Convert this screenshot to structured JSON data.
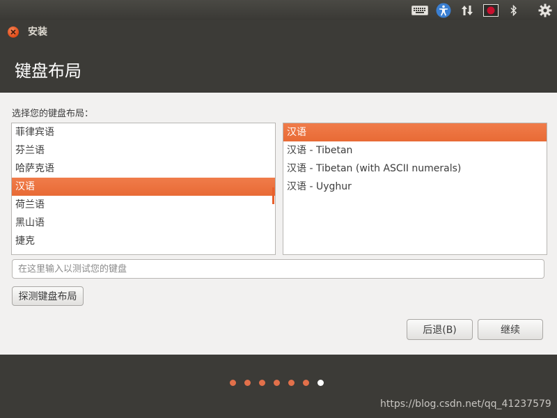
{
  "window": {
    "title": "安装"
  },
  "header": {
    "title": "键盘布局"
  },
  "keyboard": {
    "prompt": "选择您的键盘布局：",
    "layouts": [
      "菲律宾语",
      "芬兰语",
      "哈萨克语",
      "汉语",
      "荷兰语",
      "黑山语",
      "捷克"
    ],
    "selected_layout": "汉语",
    "variants": [
      "汉语",
      "汉语 - Tibetan",
      "汉语 - Tibetan (with ASCII numerals)",
      "汉语 - Uyghur"
    ],
    "selected_variant": "汉语"
  },
  "test_input": {
    "placeholder": "在这里输入以测试您的键盘",
    "value": ""
  },
  "buttons": {
    "detect": "探测键盘布局",
    "back": "后退(B)",
    "continue": "继续"
  },
  "progress": {
    "total_steps": 7,
    "current_step": 7
  },
  "watermark": "https://blog.csdn.net/qq_41237579",
  "colors": {
    "accent": "#e86a35",
    "panel": "#3c3b37",
    "content_bg": "#f2f1f0"
  },
  "tray_icons": [
    "keyboard-icon",
    "accessibility-icon",
    "network-icon",
    "record-icon",
    "bluetooth-icon",
    "settings-gear-icon"
  ]
}
